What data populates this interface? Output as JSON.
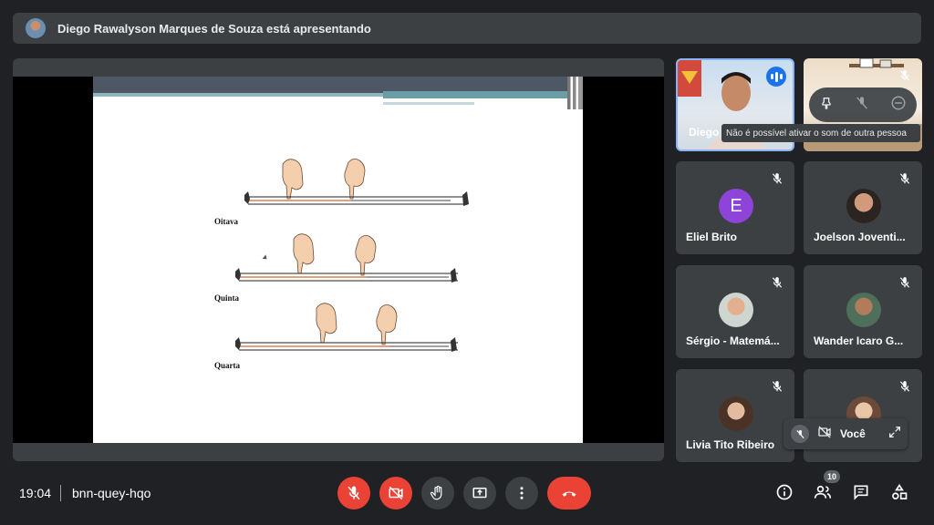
{
  "presenting": {
    "text": "Diego Rawalyson Marques de Souza está apresentando"
  },
  "slide": {
    "labels": [
      "Oitava",
      "Quinta",
      "Quarta"
    ]
  },
  "participants": {
    "diego": {
      "name": "Diego"
    },
    "tooltip": "Não é possível ativar o som de outra pessoa",
    "tiles": [
      {
        "name": "Eliel Brito",
        "letter": "E"
      },
      {
        "name": "Joelson Joventi..."
      },
      {
        "name": "Sérgio - Matemá..."
      },
      {
        "name": "Wander Icaro G..."
      },
      {
        "name": "Livia Tito Ribeiro"
      }
    ],
    "self_label": "Você"
  },
  "bottom": {
    "time": "19:04",
    "code": "bnn-quey-hqo",
    "people_count": "10"
  },
  "colors": {
    "background": "#202124",
    "surface": "#3c4043",
    "danger": "#ea4335",
    "accent": "#8ab4f8",
    "avatar_purple": "#8e44d8"
  }
}
